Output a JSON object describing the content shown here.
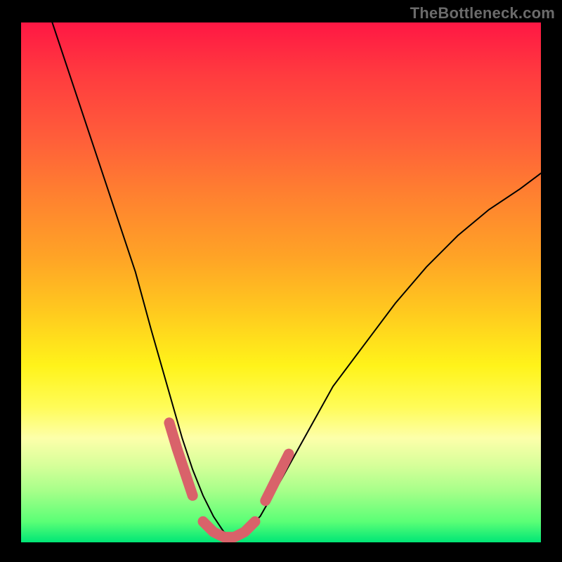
{
  "watermark": "TheBottleneck.com",
  "chart_data": {
    "type": "line",
    "title": "",
    "xlabel": "",
    "ylabel": "",
    "xlim": [
      0,
      100
    ],
    "ylim": [
      0,
      100
    ],
    "grid": false,
    "series": [
      {
        "name": "bottleneck-curve",
        "x": [
          6,
          10,
          14,
          18,
          22,
          25,
          27,
          29,
          31,
          33,
          35,
          37,
          39,
          41,
          43,
          46,
          50,
          55,
          60,
          66,
          72,
          78,
          84,
          90,
          96,
          100
        ],
        "y": [
          100,
          88,
          76,
          64,
          52,
          41,
          34,
          27,
          20,
          14,
          9,
          5,
          2,
          1,
          2,
          5,
          12,
          21,
          30,
          38,
          46,
          53,
          59,
          64,
          68,
          71
        ],
        "color": "#000000"
      }
    ],
    "highlight_segments": [
      {
        "name": "left-descent-pink",
        "x": [
          28.5,
          30,
          31.5,
          33
        ],
        "y": [
          23,
          18,
          13.5,
          9
        ],
        "color": "#d9626a"
      },
      {
        "name": "valley-floor-pink",
        "x": [
          35,
          37,
          39,
          41,
          43,
          45
        ],
        "y": [
          4,
          2,
          1,
          1,
          2,
          4
        ],
        "color": "#d9626a"
      },
      {
        "name": "right-ascent-pink",
        "x": [
          47,
          48.5,
          50,
          51.5
        ],
        "y": [
          8,
          11,
          14,
          17
        ],
        "color": "#d9626a"
      }
    ],
    "background_gradient": {
      "top": "#ff1744",
      "mid_upper": "#ff8030",
      "mid": "#fff31a",
      "mid_lower": "#d8ff9a",
      "bottom": "#00e676"
    }
  }
}
